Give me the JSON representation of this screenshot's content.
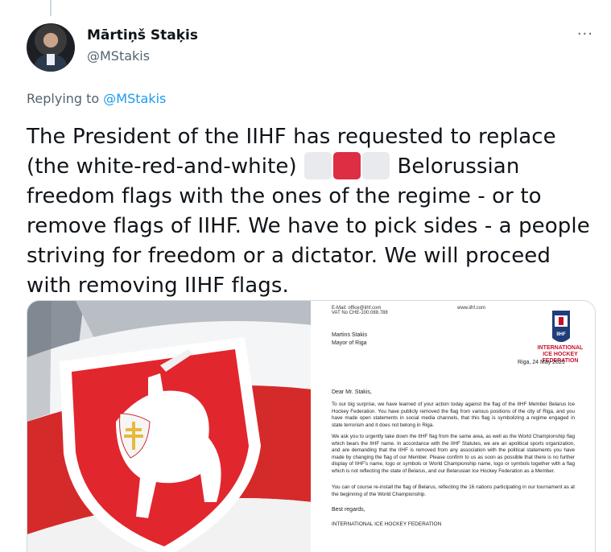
{
  "author": {
    "display_name": "Mārtiņš Staķis",
    "handle": "@MStakis"
  },
  "more_icon": "···",
  "reply": {
    "prefix": "Replying to",
    "mention": "@MStakis"
  },
  "tweet": {
    "part1": "The President of the IIHF has requested to replace (the white-red-and-white) ",
    "part2": " Belorussian freedom flags with the ones of the regime - or to remove flags of IIHF. We have to pick sides - a people striving for freedom or a  dictator. We will proceed with removing IIHF flags."
  },
  "document": {
    "header_left_1": "E-Mail: office@iihf.com",
    "header_left_2": "VAT No CHE-100.088.788",
    "header_right": "www.iihf.com",
    "logo_line1": "IIHF",
    "logo_line2": "INTERNATIONAL",
    "logo_line3": "ICE HOCKEY",
    "logo_line4": "FEDERATION",
    "recipient_name": "Martins Stakis",
    "recipient_title": "Mayor of Riga",
    "date": "Riga, 24 May 2021",
    "greeting": "Dear Mr. Stakis,",
    "paragraph1": "To our big surprise, we have learned of your action today against the flag of the IIHF Member Belarus Ice Hockey Federation. You have publicly removed the flag from various positions of the city of Riga, and you have made open statements in social media channels, that this flag is symbolizing a regime engaged in state terrorism and it does not belong in Riga.",
    "paragraph2": "We ask you to urgently take down the IIHF flag from the same area, as well as the World Championship flag which bears the IIHF name. In accordance with the IIHF Statutes, we are an apolitical sports organization, and are demanding that the IIHF is removed from any association with the political statements you have made by changing the flag of our Member. Please confirm to us as soon as possible that there is no further display of IIHF's name, logo or symbols or World Championship name, logo or symbols together with a flag which is not reflecting the state of Belarus, and our Belarusian Ice Hockey Federation as a Member.",
    "paragraph3": "You can of course re-install the flag of Belarus, reflecting the 16 nations participating in our tournament as at the beginning of the World Championship.",
    "closing": "Best regards,",
    "signature": "INTERNATIONAL ICE HOCKEY FEDERATION"
  },
  "colors": {
    "link": "#1d9bf0",
    "secondary_text": "#536471",
    "flag_red": "#dd2e44",
    "flag_white": "#e8eaed"
  }
}
